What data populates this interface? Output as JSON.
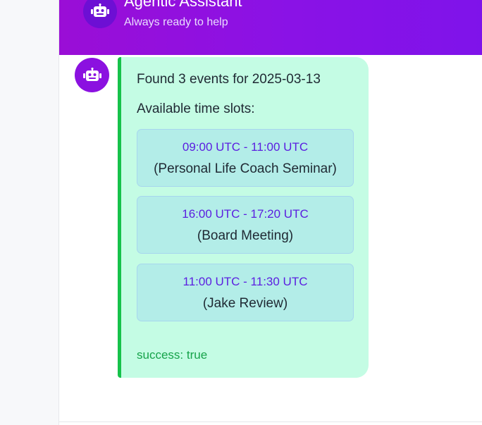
{
  "header": {
    "title": "Agentic Assistant",
    "subtitle": "Always ready to help",
    "avatar_icon": "robot-icon"
  },
  "message": {
    "avatar_icon": "robot-icon",
    "heading": "Found 3 events for 2025-03-13",
    "subheading": "Available time slots:",
    "slots": [
      {
        "time": "09:00 UTC - 11:00 UTC",
        "name": "(Personal Life Coach Seminar)"
      },
      {
        "time": "16:00 UTC - 17:20 UTC",
        "name": "(Board Meeting)"
      },
      {
        "time": "11:00 UTC - 11:30 UTC",
        "name": "(Jake Review)"
      }
    ],
    "status": "success: true"
  },
  "colors": {
    "header_gradient_start": "#9a0ed6",
    "header_gradient_end": "#7f13ea",
    "bubble_background": "#c4fce4",
    "bubble_accent": "#16c24a",
    "slot_time_text": "#5b1fe0",
    "status_text": "#16a34a"
  }
}
